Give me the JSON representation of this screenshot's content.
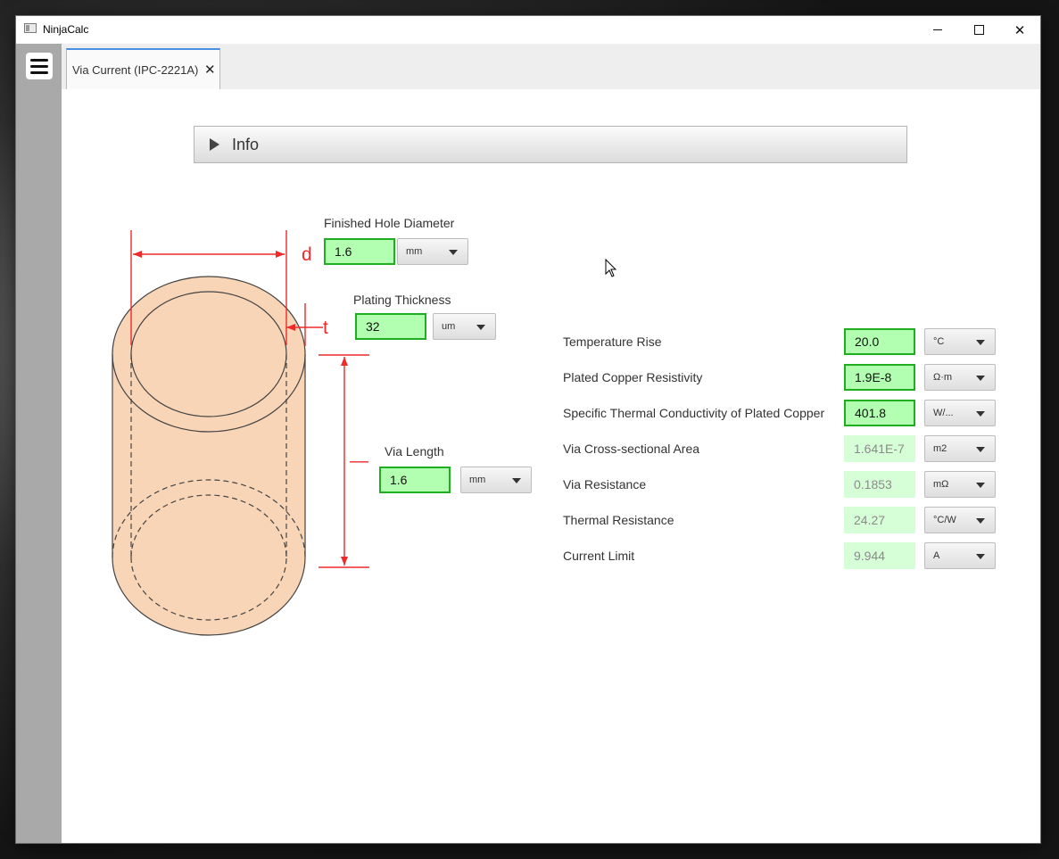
{
  "window": {
    "title": "NinjaCalc"
  },
  "tabs": [
    {
      "label": "Via Current (IPC-2221A)",
      "close_icon": "close-icon"
    }
  ],
  "info": {
    "label": "Info"
  },
  "diagram": {
    "label_d": "d",
    "label_t": "t",
    "label_l": "—"
  },
  "left_inputs": {
    "hole_diameter": {
      "label": "Finished Hole Diameter",
      "value": "1.6",
      "unit": "mm"
    },
    "plating_thickness": {
      "label": "Plating Thickness",
      "value": "32",
      "unit": "um"
    },
    "via_length": {
      "label": "Via Length",
      "value": "1.6",
      "unit": "mm"
    }
  },
  "right_rows": [
    {
      "label": "Temperature Rise",
      "value": "20.0",
      "unit": "°C",
      "kind": "input"
    },
    {
      "label": "Plated Copper Resistivity",
      "value": "1.9E-8",
      "unit": "Ω·m",
      "kind": "input"
    },
    {
      "label": "Specific Thermal Conductivity of Plated Copper",
      "value": "401.8",
      "unit": "W/...",
      "kind": "input"
    },
    {
      "label": "Via Cross-sectional Area",
      "value": "1.641E-7",
      "unit": "m2",
      "kind": "output"
    },
    {
      "label": "Via Resistance",
      "value": "0.1853",
      "unit": "mΩ",
      "kind": "output"
    },
    {
      "label": "Thermal Resistance",
      "value": "24.27",
      "unit": "°C/W",
      "kind": "output"
    },
    {
      "label": "Current Limit",
      "value": "9.944",
      "unit": "A",
      "kind": "output"
    }
  ],
  "colors": {
    "input_bg": "#b2ffb2",
    "input_border": "#1fae1f",
    "output_bg": "#d7ffd7",
    "copper": "#f9d5b7",
    "dimension": "#ee2a2a",
    "tab_accent": "#4a90e2"
  }
}
